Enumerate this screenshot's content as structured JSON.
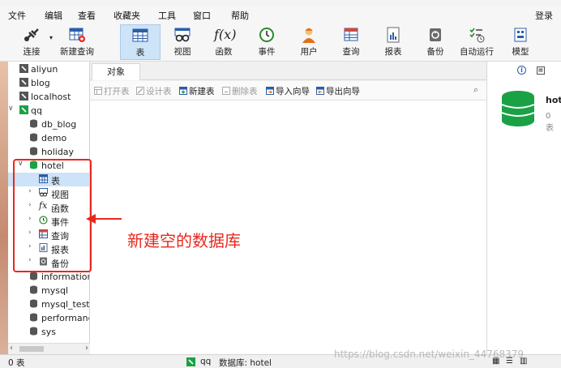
{
  "menu": {
    "items": [
      "文件",
      "编辑",
      "查看",
      "收藏夹",
      "工具",
      "窗口",
      "帮助"
    ],
    "login": "登录"
  },
  "toolbar": {
    "connect": "连接",
    "new_query": "新建查询",
    "table": "表",
    "view": "视图",
    "function": "函数",
    "event": "事件",
    "user": "用户",
    "query": "查询",
    "report": "报表",
    "backup": "备份",
    "automation": "自动运行",
    "model": "模型",
    "function_icon_text": "f(x)"
  },
  "sidebar": {
    "connections": [
      "aliyun",
      "blog",
      "localhost",
      "qq"
    ],
    "qq_databases_before": [
      "db_blog",
      "demo",
      "holiday"
    ],
    "hotel": "hotel",
    "hotel_children": [
      "表",
      "视图",
      "函数",
      "事件",
      "查询",
      "报表",
      "备份"
    ],
    "qq_databases_after": [
      "information",
      "mysql",
      "mysql_test",
      "performanc",
      "sys"
    ]
  },
  "main": {
    "tab": "对象",
    "actions": {
      "open_table": "打开表",
      "design_table": "设计表",
      "new_table": "新建表",
      "delete_table": "删除表",
      "import_wizard": "导入向导",
      "export_wizard": "导出向导"
    }
  },
  "right_panel": {
    "name": "hot",
    "sub": "0 表"
  },
  "status": {
    "left": "0 表",
    "connection": "qq",
    "database": "数据库: hotel"
  },
  "watermark": "https://blog.csdn.net/weixin_44768379",
  "annotation": "新建空的数据库",
  "colors": {
    "accent": "#cde3f7",
    "db_green": "#1aa146",
    "annotation_red": "#e8281e"
  }
}
